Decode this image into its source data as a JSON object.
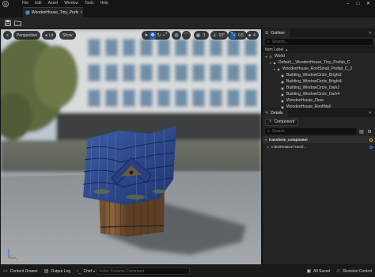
{
  "menubar": {
    "items": [
      "File",
      "Edit",
      "Asset",
      "Window",
      "Tools",
      "Help"
    ]
  },
  "document_tab": {
    "label": "WoodenHouse_Tiny_Prefab"
  },
  "viewport": {
    "view_mode_label": "Perspective",
    "lighting_label": "Lit",
    "show_label": "Show",
    "grid_snap_value": "1",
    "angle_snap_value": "10°",
    "scale_snap_value": "0.5",
    "camera_speed_value": "4"
  },
  "outliner": {
    "tab_label": "Outliner",
    "search_placeholder": "Search...",
    "column_header": "Item Label",
    "items": [
      {
        "label": "World",
        "depth": 0,
        "expander": "▾",
        "icon": "world-icon"
      },
      {
        "label": "Default__WoodenHouse_Tiny_Prefab_C",
        "depth": 1,
        "expander": "▾",
        "icon": "actor-icon"
      },
      {
        "label": "WoodenHouse_RoofSmall_Prefab_C_2",
        "depth": 2,
        "expander": "▾",
        "icon": "actor-icon"
      },
      {
        "label": "Building_WindowCircle_Bright2",
        "depth": 3,
        "expander": "",
        "icon": "static-mesh-icon"
      },
      {
        "label": "Building_WindowCircle_Bright4",
        "depth": 3,
        "expander": "",
        "icon": "static-mesh-icon"
      },
      {
        "label": "Building_WindowCircle_Dark2",
        "depth": 3,
        "expander": "",
        "icon": "static-mesh-icon"
      },
      {
        "label": "Building_WindowCircle_Dark4",
        "depth": 3,
        "expander": "",
        "icon": "static-mesh-icon"
      },
      {
        "label": "WoodenHouse_Floor",
        "depth": 3,
        "expander": "",
        "icon": "static-mesh-icon"
      },
      {
        "label": "WoodenHouse_RoofWall",
        "depth": 3,
        "expander": "",
        "icon": "static-mesh-icon"
      }
    ]
  },
  "details": {
    "tab_label": "Details",
    "add_component_label": "Component",
    "search_placeholder": "Search",
    "section_label": "transform_component",
    "property_label": "InitialRelativeTransf..."
  },
  "statusbar": {
    "content_drawer_label": "Content Drawer",
    "output_log_label": "Output Log",
    "cmd_label": "Cmd",
    "console_placeholder": "Enter Console Command",
    "saved_label": "All Saved",
    "revision_label": "Revision Control"
  },
  "colors": {
    "accent": "#1f5ea8",
    "add_green": "#49b24b",
    "panel_bg": "#242424",
    "bar_bg": "#151515"
  }
}
